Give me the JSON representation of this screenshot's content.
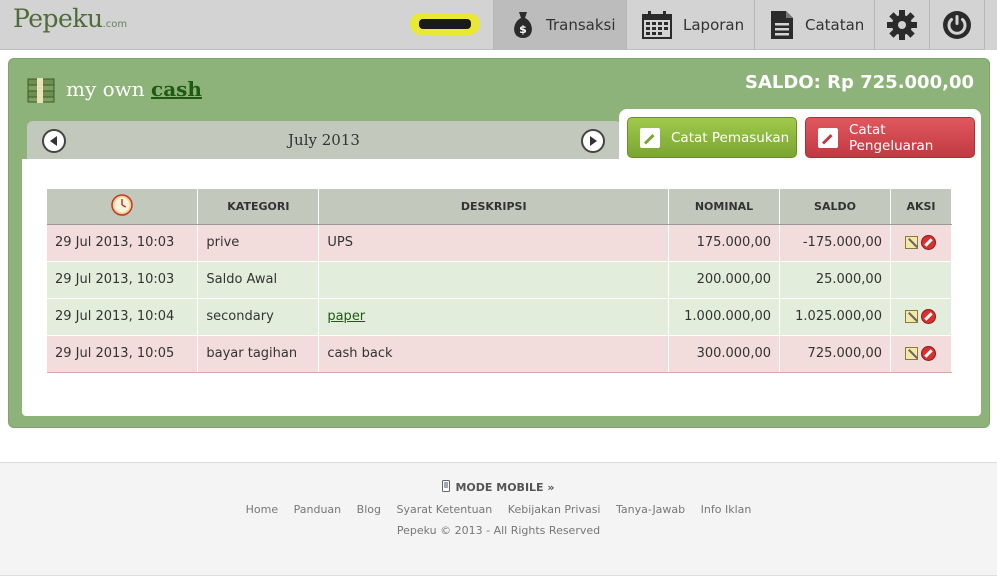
{
  "app": {
    "logo_text": "Pepeku",
    "logo_suffix": ".com",
    "user_name": ""
  },
  "nav": {
    "transaksi": "Transaksi",
    "laporan": "Laporan",
    "catatan": "Catatan",
    "active": "Transaksi"
  },
  "account": {
    "prefix": "my own",
    "name": "cash",
    "saldo_label": "SALDO: Rp 725.000,00"
  },
  "month": {
    "label": "July 2013"
  },
  "actions": {
    "income_label": "Catat Pemasukan",
    "expense_label": "Catat Pengeluaran"
  },
  "table": {
    "headers": {
      "time_icon": "clock-icon",
      "kategori": "KATEGORI",
      "deskripsi": "DESKRIPSI",
      "nominal": "NOMINAL",
      "saldo": "SALDO",
      "aksi": "AKSI"
    },
    "rows": [
      {
        "date": "29 Jul 2013, 10:03",
        "kategori": "prive",
        "deskripsi": "UPS",
        "nominal": "175.000,00",
        "saldo": "-175.000,00",
        "type": "expense",
        "actions": true
      },
      {
        "date": "29 Jul 2013, 10:03",
        "kategori": "Saldo Awal",
        "deskripsi": "",
        "nominal": "200.000,00",
        "saldo": "25.000,00",
        "type": "income",
        "actions": false
      },
      {
        "date": "29 Jul 2013, 10:04",
        "kategori": "secondary",
        "deskripsi": "paper",
        "nominal": "1.000.000,00",
        "saldo": "1.025.000,00",
        "type": "income",
        "actions": true
      },
      {
        "date": "29 Jul 2013, 10:05",
        "kategori": "bayar tagihan",
        "deskripsi": "cash back",
        "nominal": "300.000,00",
        "saldo": "725.000,00",
        "type": "expense",
        "actions": true
      }
    ]
  },
  "footer": {
    "mobile_mode": "MODE MOBILE »",
    "links": [
      "Home",
      "Panduan",
      "Blog",
      "Syarat Ketentuan",
      "Kebijakan Privasi",
      "Tanya-Jawab",
      "Info Iklan"
    ],
    "copyright": "Pepeku © 2013 - All Rights Reserved"
  },
  "colors": {
    "panel_green": "#8db37a",
    "income_row": "#e2eedb",
    "expense_row": "#f2dcdc",
    "income_button": "#8bb83e",
    "expense_button": "#d3474e"
  }
}
